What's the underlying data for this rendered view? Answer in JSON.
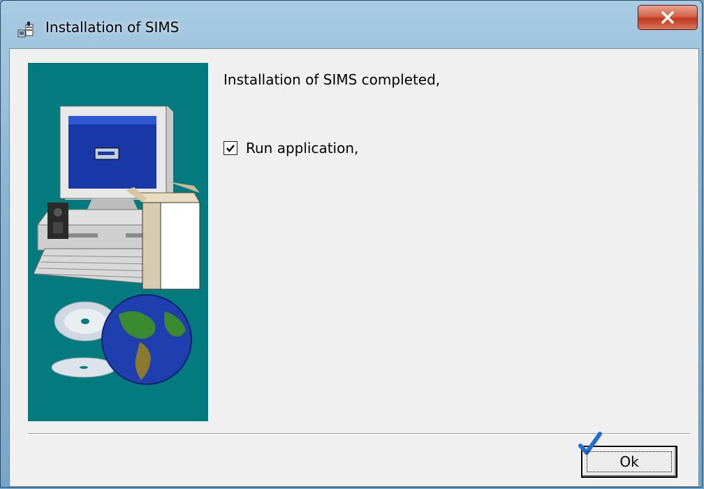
{
  "window": {
    "title": "Installation of SIMS",
    "icon": "installer-icon",
    "close_icon": "close-x-icon"
  },
  "content": {
    "message": "Installation of SIMS completed,",
    "run_checkbox": {
      "label": "Run application,",
      "checked": true
    }
  },
  "footer": {
    "ok_label": "Ok",
    "ok_icon": "checkmark-icon"
  },
  "colors": {
    "side_panel": "#037a7d",
    "client_bg": "#f0f0f0",
    "close_red": "#c23a1f"
  }
}
